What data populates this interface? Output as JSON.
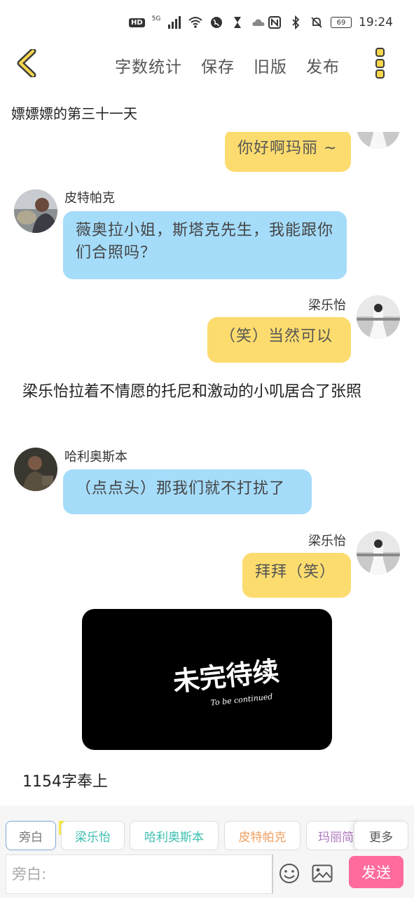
{
  "status_bar": {
    "hd": "HD",
    "signal": "5G",
    "battery": "69",
    "time": "19:24"
  },
  "nav": {
    "word_count_label": "字数统计",
    "save_label": "保存",
    "old_version_label": "旧版",
    "publish_label": "发布"
  },
  "chapter": {
    "title": "嫖嫖嫖的第三十一天"
  },
  "messages": [
    {
      "side": "right",
      "speaker": "",
      "text": "你好啊玛丽 ~",
      "color": "#fcdc6e"
    },
    {
      "side": "left",
      "speaker": "皮特帕克",
      "text": "薇奥拉小姐，斯塔克先生，我能跟你们合照吗？",
      "color": "#a5dcfa"
    },
    {
      "side": "right",
      "speaker": "梁乐怡",
      "text": "（笑）当然可以",
      "color": "#fcdc6e"
    },
    {
      "side": "narration",
      "text": "梁乐怡拉着不情愿的托尼和激动的小叽居合了张照"
    },
    {
      "side": "left",
      "speaker": "哈利奥斯本",
      "text": "（点点头）那我们就不打扰了",
      "color": "#a5dcfa"
    },
    {
      "side": "right",
      "speaker": "梁乐怡",
      "text": "拜拜（笑）",
      "color": "#fcdc6e"
    }
  ],
  "tbc_image": {
    "main_text": "未完待续",
    "sub_text": "To be continued"
  },
  "word_count_text": "1154字奉上",
  "roles": [
    {
      "label": "旁白",
      "color": "#777777",
      "selected": true
    },
    {
      "label": "梁乐怡",
      "color": "#3cbfb0",
      "host_tag": "主"
    },
    {
      "label": "哈利奥斯本",
      "color": "#3cbfb0"
    },
    {
      "label": "皮特帕克",
      "color": "#f0a060"
    },
    {
      "label": "玛丽简",
      "color": "#b07ac0"
    }
  ],
  "more_label": "更多",
  "input": {
    "placeholder": "旁白:"
  },
  "send_label": "发送",
  "accent": {
    "yellow": "#fcdc6e",
    "blue": "#a5dcfa",
    "pink": "#ff6b9c"
  }
}
